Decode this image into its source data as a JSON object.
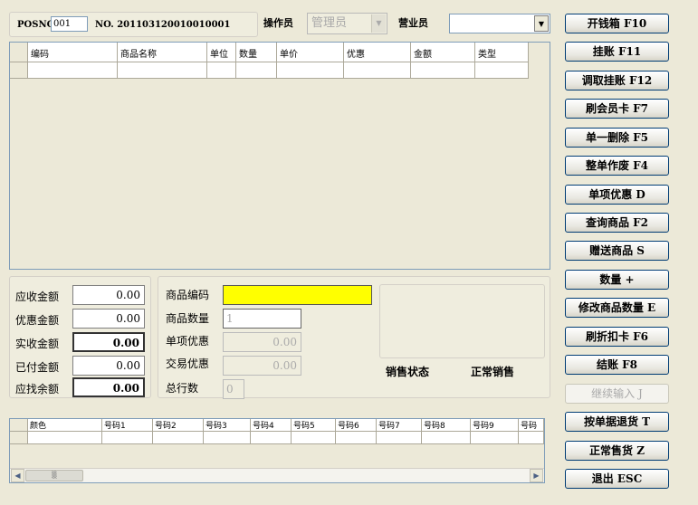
{
  "header": {
    "posno_label": "POSNO",
    "posno_value": "001",
    "no_label": "NO. 201103120010010001",
    "operator_label": "操作员",
    "operator_value": "管理员",
    "sales_label": "营业员",
    "sales_value": ""
  },
  "main_grid": {
    "columns": [
      "编码",
      "商品名称",
      "单位",
      "数量",
      "单价",
      "优惠",
      "金额",
      "类型"
    ]
  },
  "summary": {
    "receivable_label": "应收金额",
    "receivable_value": "0.00",
    "discount_label": "优惠金额",
    "discount_value": "0.00",
    "actual_label": "实收金额",
    "actual_value": "0.00",
    "paid_label": "已付金额",
    "paid_value": "0.00",
    "change_label": "应找余额",
    "change_value": "0.00"
  },
  "product": {
    "code_label": "商品编码",
    "code_value": "",
    "qty_label": "商品数量",
    "qty_value": "1",
    "item_discount_label": "单项优惠",
    "item_discount_value": "0.00",
    "trade_discount_label": "交易优惠",
    "trade_discount_value": "0.00",
    "total_rows_label": "总行数",
    "total_rows_value": "0",
    "status_label": "销售状态",
    "status_value": "正常销售"
  },
  "size_grid": {
    "columns": [
      "颜色",
      "号码1",
      "号码2",
      "号码3",
      "号码4",
      "号码5",
      "号码6",
      "号码7",
      "号码8",
      "号码9",
      "号码"
    ]
  },
  "buttons": [
    {
      "label": "开钱箱  F10"
    },
    {
      "label": "挂账  F11"
    },
    {
      "label": "调取挂账  F12"
    },
    {
      "label": "刷会员卡  F7"
    },
    {
      "label": "单一删除  F5"
    },
    {
      "label": "整单作废  F4"
    },
    {
      "label": "单项优惠  D"
    },
    {
      "label": "查询商品  F2"
    },
    {
      "label": "赠送商品  S"
    },
    {
      "label": "数量  +"
    },
    {
      "label": "修改商品数量  E"
    },
    {
      "label": "刷折扣卡  F6"
    },
    {
      "label": "结账  F8"
    },
    {
      "label": "继续输入  J"
    },
    {
      "label": "按单据退货  T"
    },
    {
      "label": "正常售货  Z"
    },
    {
      "label": "退出  ESC"
    }
  ]
}
